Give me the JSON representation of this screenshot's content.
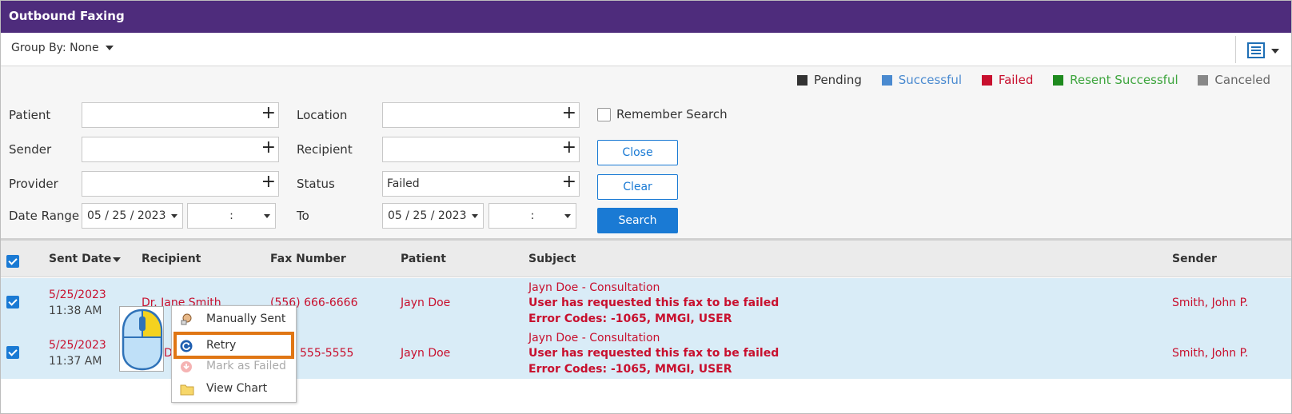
{
  "app": {
    "title": "Outbound Faxing"
  },
  "toolbar": {
    "group_by": "Group By: None"
  },
  "legend": [
    {
      "label": "Pending",
      "color": "#333333"
    },
    {
      "label": "Successful",
      "color": "#4a8ad0"
    },
    {
      "label": "Failed",
      "color": "#c8102e"
    },
    {
      "label": "Resent Successful",
      "color": "#1e8a1e"
    },
    {
      "label": "Canceled",
      "color": "#888888"
    }
  ],
  "filters": {
    "patient_label": "Patient",
    "sender_label": "Sender",
    "provider_label": "Provider",
    "date_range_label": "Date Range",
    "location_label": "Location",
    "recipient_label": "Recipient",
    "status_label": "Status",
    "to_label": "To",
    "status_value": "Failed",
    "date_from": "05  /  25  /  2023",
    "date_to": "05  /  25  /  2023",
    "time_from": ":",
    "time_to": ":",
    "remember_label": "Remember Search",
    "close_label": "Close",
    "clear_label": "Clear",
    "search_label": "Search"
  },
  "table": {
    "headers": {
      "sent_date": "Sent Date",
      "recipient": "Recipient",
      "fax_number": "Fax Number",
      "patient": "Patient",
      "subject": "Subject",
      "sender": "Sender"
    },
    "rows": [
      {
        "date": "5/25/2023",
        "time": "11:38 AM",
        "recipient": "Dr. Jane Smith",
        "fax": "(556) 666-6666",
        "patient": "Jayn Doe",
        "subject_title": "Jayn Doe - Consultation",
        "subject_msg": "User has requested this fax to be failed",
        "subject_codes": "Error Codes: -1065, MMGI, USER",
        "sender": "Smith, John P."
      },
      {
        "date": "5/25/2023",
        "time": "11:37 AM",
        "recipient": "Do",
        "fax": "555-5555",
        "patient": "Jayn Doe",
        "subject_title": "Jayn Doe - Consultation",
        "subject_msg": "User has requested this fax to be failed",
        "subject_codes": "Error Codes: -1065, MMGI, USER",
        "sender": "Smith, John P."
      }
    ]
  },
  "context_menu": {
    "items": [
      {
        "label": "Manually Sent",
        "icon": "manual-sent-icon"
      },
      {
        "label": "Retry",
        "icon": "retry-icon"
      },
      {
        "label": "Mark as Failed",
        "icon": "mark-failed-icon"
      },
      {
        "label": "View Chart",
        "icon": "folder-icon"
      }
    ]
  }
}
